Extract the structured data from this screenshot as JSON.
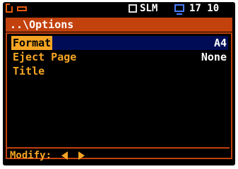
{
  "statusbar": {
    "mode": "SLM",
    "time": "17 10"
  },
  "titlebar": {
    "title": "..\\Options"
  },
  "options": [
    {
      "label": "Format",
      "value": "A4"
    },
    {
      "label": "Eject Page",
      "value": "None"
    },
    {
      "label": "Title",
      "value": ""
    }
  ],
  "footer": {
    "modify_label": "Modify:"
  },
  "colors": {
    "accent": "#c2410c",
    "label": "#f5a524",
    "selection": "#000d56"
  }
}
